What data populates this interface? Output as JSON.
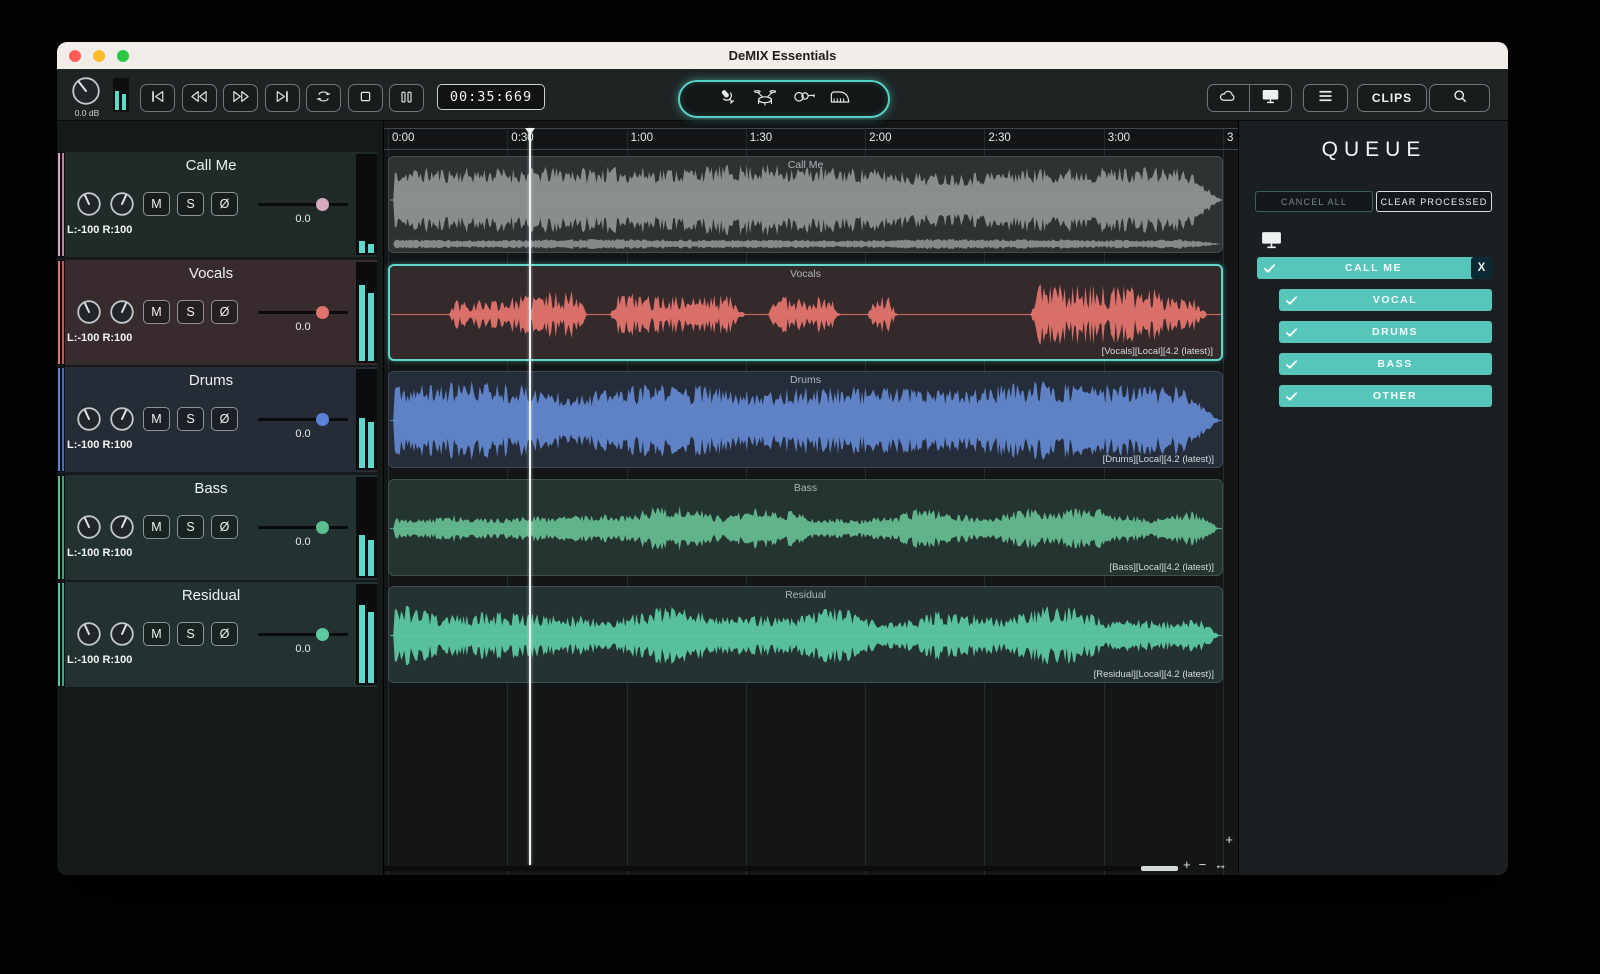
{
  "titlebar": {
    "title": "DeMIX Essentials"
  },
  "toolbar": {
    "gain_label": "0.0 dB",
    "time": "00:35:669",
    "clips": "CLIPS",
    "transport": [
      "skip-start",
      "rewind",
      "fast-forward",
      "skip-end",
      "loop",
      "stop",
      "pause"
    ],
    "instruments": [
      "microphone",
      "drum-kit",
      "guitar",
      "piano"
    ],
    "meter_levels": [
      0.62,
      0.52
    ]
  },
  "ruler": {
    "ticks": [
      "0:00",
      "0:30",
      "1:00",
      "1:30",
      "2:00",
      "2:30",
      "3:00",
      "3"
    ]
  },
  "track_controls": {
    "mute": "M",
    "solo": "S",
    "phase": "Ø"
  },
  "tracks": [
    {
      "name": "Call Me",
      "pan": "L:-100 R:100",
      "gain": "0.0",
      "color": "#d9a9c0",
      "wave": "#8e9293",
      "clip_bg": "#2e3233",
      "clip_border": "#474d4f",
      "header_bg": "#1f2a29",
      "tag": "",
      "profile": "callme",
      "meters": [
        0.12,
        0.09
      ],
      "selected": false
    },
    {
      "name": "Vocals",
      "pan": "L:-100 R:100",
      "gain": "0.0",
      "color": "#e0736b",
      "wave": "#e2736c",
      "clip_bg": "#342a2c",
      "clip_border": "#5fd8cb",
      "header_bg": "#372b2d",
      "tag": "[Vocals][Local][4.2 (latest)]",
      "profile": "vocals",
      "meters": [
        0.78,
        0.7
      ],
      "selected": true
    },
    {
      "name": "Drums",
      "pan": "L:-100 R:100",
      "gain": "0.0",
      "color": "#5b82d6",
      "wave": "#6287cf",
      "clip_bg": "#262d3a",
      "clip_border": "#3e4757",
      "header_bg": "#262c36",
      "tag": "[Drums][Local][4.2 (latest)]",
      "profile": "drums",
      "meters": [
        0.52,
        0.47
      ],
      "selected": false
    },
    {
      "name": "Bass",
      "pan": "L:-100 R:100",
      "gain": "0.0",
      "color": "#5cbd8e",
      "wave": "#64bb8f",
      "clip_bg": "#243430",
      "clip_border": "#3d5249",
      "header_bg": "#233230",
      "tag": "[Bass][Local][4.2 (latest)]",
      "profile": "bass",
      "meters": [
        0.42,
        0.37
      ],
      "selected": false
    },
    {
      "name": "Residual",
      "pan": "L:-100 R:100",
      "gain": "0.0",
      "color": "#5cc9a0",
      "wave": "#5cc9a2",
      "clip_bg": "#243332",
      "clip_border": "#3d524e",
      "header_bg": "#233231",
      "tag": "[Residual][Local][4.2 (latest)]",
      "profile": "residual",
      "meters": [
        0.8,
        0.73
      ],
      "selected": false
    }
  ],
  "playhead_time_seconds": 35.669,
  "queue": {
    "title": "QUEUE",
    "cancel_all": "CANCEL ALL",
    "clear_processed": "CLEAR PROCESSED",
    "close_glyph": "X",
    "accent": "#57c6ba",
    "items": [
      {
        "label": "CALL ME",
        "checked": true,
        "closable": true,
        "level": 0
      },
      {
        "label": "VOCAL",
        "checked": true,
        "closable": false,
        "level": 1
      },
      {
        "label": "DRUMS",
        "checked": true,
        "closable": false,
        "level": 1
      },
      {
        "label": "BASS",
        "checked": true,
        "closable": false,
        "level": 1
      },
      {
        "label": "OTHER",
        "checked": true,
        "closable": false,
        "level": 1
      }
    ]
  },
  "scrollbar": {
    "zoom_in": "+",
    "zoom_out": "−",
    "fit": "↔",
    "v_zoom": "+"
  },
  "colors": {
    "accent": "#5fd8cb",
    "meter": "#5fd8cb"
  }
}
